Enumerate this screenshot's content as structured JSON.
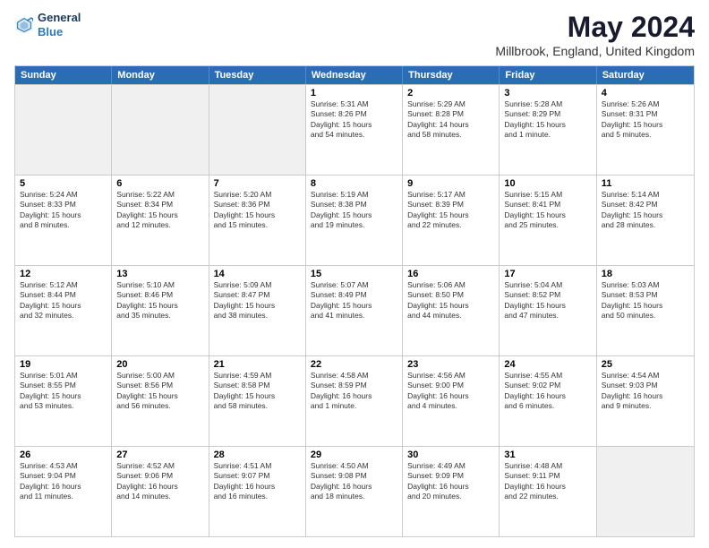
{
  "header": {
    "logo_line1": "General",
    "logo_line2": "Blue",
    "title": "May 2024",
    "subtitle": "Millbrook, England, United Kingdom"
  },
  "weekdays": [
    "Sunday",
    "Monday",
    "Tuesday",
    "Wednesday",
    "Thursday",
    "Friday",
    "Saturday"
  ],
  "rows": [
    [
      {
        "day": "",
        "lines": [],
        "shaded": true
      },
      {
        "day": "",
        "lines": [],
        "shaded": true
      },
      {
        "day": "",
        "lines": [],
        "shaded": true
      },
      {
        "day": "1",
        "lines": [
          "Sunrise: 5:31 AM",
          "Sunset: 8:26 PM",
          "Daylight: 15 hours",
          "and 54 minutes."
        ]
      },
      {
        "day": "2",
        "lines": [
          "Sunrise: 5:29 AM",
          "Sunset: 8:28 PM",
          "Daylight: 14 hours",
          "and 58 minutes."
        ]
      },
      {
        "day": "3",
        "lines": [
          "Sunrise: 5:28 AM",
          "Sunset: 8:29 PM",
          "Daylight: 15 hours",
          "and 1 minute."
        ]
      },
      {
        "day": "4",
        "lines": [
          "Sunrise: 5:26 AM",
          "Sunset: 8:31 PM",
          "Daylight: 15 hours",
          "and 5 minutes."
        ]
      }
    ],
    [
      {
        "day": "5",
        "lines": [
          "Sunrise: 5:24 AM",
          "Sunset: 8:33 PM",
          "Daylight: 15 hours",
          "and 8 minutes."
        ]
      },
      {
        "day": "6",
        "lines": [
          "Sunrise: 5:22 AM",
          "Sunset: 8:34 PM",
          "Daylight: 15 hours",
          "and 12 minutes."
        ]
      },
      {
        "day": "7",
        "lines": [
          "Sunrise: 5:20 AM",
          "Sunset: 8:36 PM",
          "Daylight: 15 hours",
          "and 15 minutes."
        ]
      },
      {
        "day": "8",
        "lines": [
          "Sunrise: 5:19 AM",
          "Sunset: 8:38 PM",
          "Daylight: 15 hours",
          "and 19 minutes."
        ]
      },
      {
        "day": "9",
        "lines": [
          "Sunrise: 5:17 AM",
          "Sunset: 8:39 PM",
          "Daylight: 15 hours",
          "and 22 minutes."
        ]
      },
      {
        "day": "10",
        "lines": [
          "Sunrise: 5:15 AM",
          "Sunset: 8:41 PM",
          "Daylight: 15 hours",
          "and 25 minutes."
        ]
      },
      {
        "day": "11",
        "lines": [
          "Sunrise: 5:14 AM",
          "Sunset: 8:42 PM",
          "Daylight: 15 hours",
          "and 28 minutes."
        ]
      }
    ],
    [
      {
        "day": "12",
        "lines": [
          "Sunrise: 5:12 AM",
          "Sunset: 8:44 PM",
          "Daylight: 15 hours",
          "and 32 minutes."
        ]
      },
      {
        "day": "13",
        "lines": [
          "Sunrise: 5:10 AM",
          "Sunset: 8:46 PM",
          "Daylight: 15 hours",
          "and 35 minutes."
        ]
      },
      {
        "day": "14",
        "lines": [
          "Sunrise: 5:09 AM",
          "Sunset: 8:47 PM",
          "Daylight: 15 hours",
          "and 38 minutes."
        ]
      },
      {
        "day": "15",
        "lines": [
          "Sunrise: 5:07 AM",
          "Sunset: 8:49 PM",
          "Daylight: 15 hours",
          "and 41 minutes."
        ]
      },
      {
        "day": "16",
        "lines": [
          "Sunrise: 5:06 AM",
          "Sunset: 8:50 PM",
          "Daylight: 15 hours",
          "and 44 minutes."
        ]
      },
      {
        "day": "17",
        "lines": [
          "Sunrise: 5:04 AM",
          "Sunset: 8:52 PM",
          "Daylight: 15 hours",
          "and 47 minutes."
        ]
      },
      {
        "day": "18",
        "lines": [
          "Sunrise: 5:03 AM",
          "Sunset: 8:53 PM",
          "Daylight: 15 hours",
          "and 50 minutes."
        ]
      }
    ],
    [
      {
        "day": "19",
        "lines": [
          "Sunrise: 5:01 AM",
          "Sunset: 8:55 PM",
          "Daylight: 15 hours",
          "and 53 minutes."
        ]
      },
      {
        "day": "20",
        "lines": [
          "Sunrise: 5:00 AM",
          "Sunset: 8:56 PM",
          "Daylight: 15 hours",
          "and 56 minutes."
        ]
      },
      {
        "day": "21",
        "lines": [
          "Sunrise: 4:59 AM",
          "Sunset: 8:58 PM",
          "Daylight: 15 hours",
          "and 58 minutes."
        ]
      },
      {
        "day": "22",
        "lines": [
          "Sunrise: 4:58 AM",
          "Sunset: 8:59 PM",
          "Daylight: 16 hours",
          "and 1 minute."
        ]
      },
      {
        "day": "23",
        "lines": [
          "Sunrise: 4:56 AM",
          "Sunset: 9:00 PM",
          "Daylight: 16 hours",
          "and 4 minutes."
        ]
      },
      {
        "day": "24",
        "lines": [
          "Sunrise: 4:55 AM",
          "Sunset: 9:02 PM",
          "Daylight: 16 hours",
          "and 6 minutes."
        ]
      },
      {
        "day": "25",
        "lines": [
          "Sunrise: 4:54 AM",
          "Sunset: 9:03 PM",
          "Daylight: 16 hours",
          "and 9 minutes."
        ]
      }
    ],
    [
      {
        "day": "26",
        "lines": [
          "Sunrise: 4:53 AM",
          "Sunset: 9:04 PM",
          "Daylight: 16 hours",
          "and 11 minutes."
        ]
      },
      {
        "day": "27",
        "lines": [
          "Sunrise: 4:52 AM",
          "Sunset: 9:06 PM",
          "Daylight: 16 hours",
          "and 14 minutes."
        ]
      },
      {
        "day": "28",
        "lines": [
          "Sunrise: 4:51 AM",
          "Sunset: 9:07 PM",
          "Daylight: 16 hours",
          "and 16 minutes."
        ]
      },
      {
        "day": "29",
        "lines": [
          "Sunrise: 4:50 AM",
          "Sunset: 9:08 PM",
          "Daylight: 16 hours",
          "and 18 minutes."
        ]
      },
      {
        "day": "30",
        "lines": [
          "Sunrise: 4:49 AM",
          "Sunset: 9:09 PM",
          "Daylight: 16 hours",
          "and 20 minutes."
        ]
      },
      {
        "day": "31",
        "lines": [
          "Sunrise: 4:48 AM",
          "Sunset: 9:11 PM",
          "Daylight: 16 hours",
          "and 22 minutes."
        ]
      },
      {
        "day": "",
        "lines": [],
        "shaded": true
      }
    ]
  ]
}
